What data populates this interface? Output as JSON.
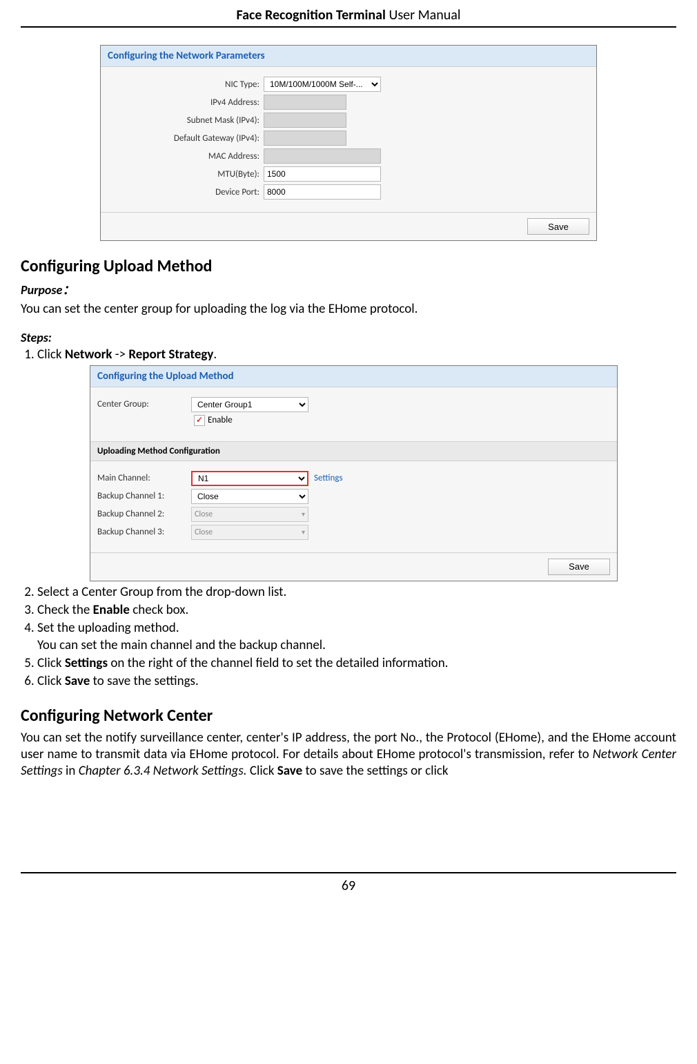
{
  "header": {
    "bold": "Face Recognition Terminal",
    "rest": "User Manual"
  },
  "footer": {
    "page_number": "69"
  },
  "figure1": {
    "title": "Configuring the Network Parameters",
    "labels": {
      "nic_type": "NIC Type:",
      "ipv4": "IPv4 Address:",
      "subnet": "Subnet Mask (IPv4):",
      "gateway": "Default Gateway (IPv4):",
      "mac": "MAC Address:",
      "mtu": "MTU(Byte):",
      "port": "Device Port:"
    },
    "values": {
      "nic_type": "10M/100M/1000M Self-...",
      "mtu": "1500",
      "port": "8000"
    },
    "save": "Save"
  },
  "section1": {
    "title": "Configuring Upload Method",
    "purpose_label": "Purpose：",
    "purpose_text": "You can set the center group for uploading the log via the EHome protocol.",
    "steps_label": "Steps:",
    "step1_prefix": "Click ",
    "step1_b1": "Network",
    "step1_mid": " -> ",
    "step1_b2": "Report Strategy",
    "step1_suffix": "."
  },
  "figure2": {
    "title": "Configuring the Upload Method",
    "labels": {
      "center_group": "Center Group:",
      "enable": "Enable",
      "sub": "Uploading Method Configuration",
      "main_channel": "Main Channel:",
      "bk1": "Backup Channel 1:",
      "bk2": "Backup Channel 2:",
      "bk3": "Backup Channel 3:",
      "settings": "Settings"
    },
    "values": {
      "center_group": "Center Group1",
      "main_channel": "N1",
      "close": "Close"
    },
    "save": "Save"
  },
  "steps_after": {
    "s2": "Select a Center Group from the drop-down list.",
    "s3_a": "Check the ",
    "s3_b": "Enable",
    "s3_c": " check box.",
    "s4": "Set the uploading method.",
    "s4_sub": "You can set the main channel and the backup channel.",
    "s5_a": "Click ",
    "s5_b": "Settings",
    "s5_c": " on the right of the channel field to set the detailed information.",
    "s6_a": "Click ",
    "s6_b": "Save",
    "s6_c": " to save the settings."
  },
  "section2": {
    "title": "Configuring Network Center",
    "para_a": "You can set the notify surveillance center, center's IP address, the port No., the Protocol (EHome), and the EHome account user name to transmit data via EHome protocol. For details about EHome protocol's transmission, refer to ",
    "para_i1": "Network Center Settings",
    "para_b": " in ",
    "para_i2": "Chapter 6.3.4 Network Settings.",
    "para_c": " Click ",
    "para_bold": "Save",
    "para_d": " to save the settings or click"
  }
}
